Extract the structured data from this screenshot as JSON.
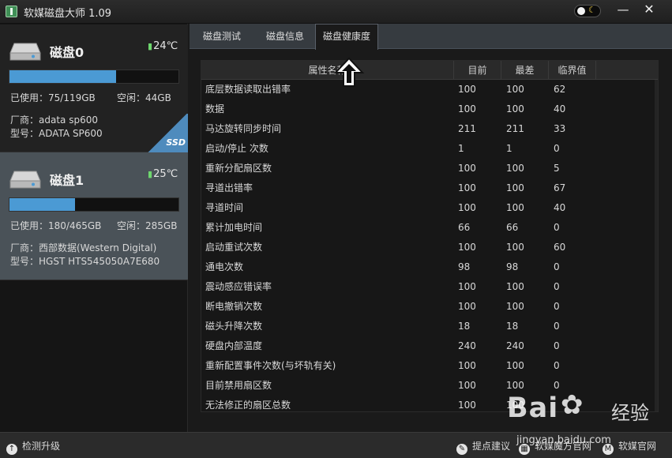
{
  "window": {
    "title": "软媒磁盘大师 1.09",
    "controls": [
      "minimize",
      "close"
    ]
  },
  "disks": [
    {
      "name": "磁盘0",
      "temperature": "24℃",
      "used_label": "已使用：75/119GB",
      "free_label": "空闲：44GB",
      "vendor_label": "厂商：adata sp600",
      "model_label": "型号：ADATA SP600",
      "usage_fraction": 0.63,
      "badge": "SSD",
      "selected": false
    },
    {
      "name": "磁盘1",
      "temperature": "25℃",
      "used_label": "已使用：180/465GB",
      "free_label": "空闲：285GB",
      "vendor_label": "厂商：西部数据(Western Digital)",
      "model_label": "型号：HGST HTS545050A7E680",
      "usage_fraction": 0.387,
      "badge": "",
      "selected": true
    }
  ],
  "tabs": [
    {
      "label": "磁盘测试",
      "active": false
    },
    {
      "label": "磁盘信息",
      "active": false
    },
    {
      "label": "磁盘健康度",
      "active": true
    }
  ],
  "table": {
    "headers": {
      "name": "属性名称",
      "current": "目前",
      "worst": "最差",
      "threshold": "临界值"
    },
    "rows": [
      {
        "name": "底层数据读取出错率",
        "current": "100",
        "worst": "100",
        "threshold": "62"
      },
      {
        "name": "数据",
        "current": "100",
        "worst": "100",
        "threshold": "40"
      },
      {
        "name": "马达旋转同步时间",
        "current": "211",
        "worst": "211",
        "threshold": "33"
      },
      {
        "name": "启动/停止 次数",
        "current": "1",
        "worst": "1",
        "threshold": "0"
      },
      {
        "name": "重新分配扇区数",
        "current": "100",
        "worst": "100",
        "threshold": "5"
      },
      {
        "name": "寻道出错率",
        "current": "100",
        "worst": "100",
        "threshold": "67"
      },
      {
        "name": "寻道时间",
        "current": "100",
        "worst": "100",
        "threshold": "40"
      },
      {
        "name": "累计加电时间",
        "current": "66",
        "worst": "66",
        "threshold": "0"
      },
      {
        "name": "启动重试次数",
        "current": "100",
        "worst": "100",
        "threshold": "60"
      },
      {
        "name": "通电次数",
        "current": "98",
        "worst": "98",
        "threshold": "0"
      },
      {
        "name": "震动感应错误率",
        "current": "100",
        "worst": "100",
        "threshold": "0"
      },
      {
        "name": "断电撤销次数",
        "current": "100",
        "worst": "100",
        "threshold": "0"
      },
      {
        "name": "磁头升降次数",
        "current": "18",
        "worst": "18",
        "threshold": "0"
      },
      {
        "name": "硬盘内部温度",
        "current": "240",
        "worst": "240",
        "threshold": "0"
      },
      {
        "name": "重新配置事件次数(与坏轨有关)",
        "current": "100",
        "worst": "100",
        "threshold": "0"
      },
      {
        "name": "目前禁用扇区数",
        "current": "100",
        "worst": "100",
        "threshold": "0"
      },
      {
        "name": "无法修正的扇区总数",
        "current": "100",
        "worst": "100",
        "threshold": ""
      }
    ]
  },
  "status_bar": {
    "update_label": "检测升级",
    "suggest_label": "提点建议",
    "magic_site_label": "软媒魔方官网",
    "official_site_label": "软媒官网"
  },
  "watermark": {
    "main": "Bai",
    "suffix": "经验",
    "sub": "jingyan.baidu.com"
  },
  "colors": {
    "accent_blue": "#4b9ad4",
    "temperature_green": "#6ed76e",
    "selected_disk_bg": "#4a5258"
  }
}
